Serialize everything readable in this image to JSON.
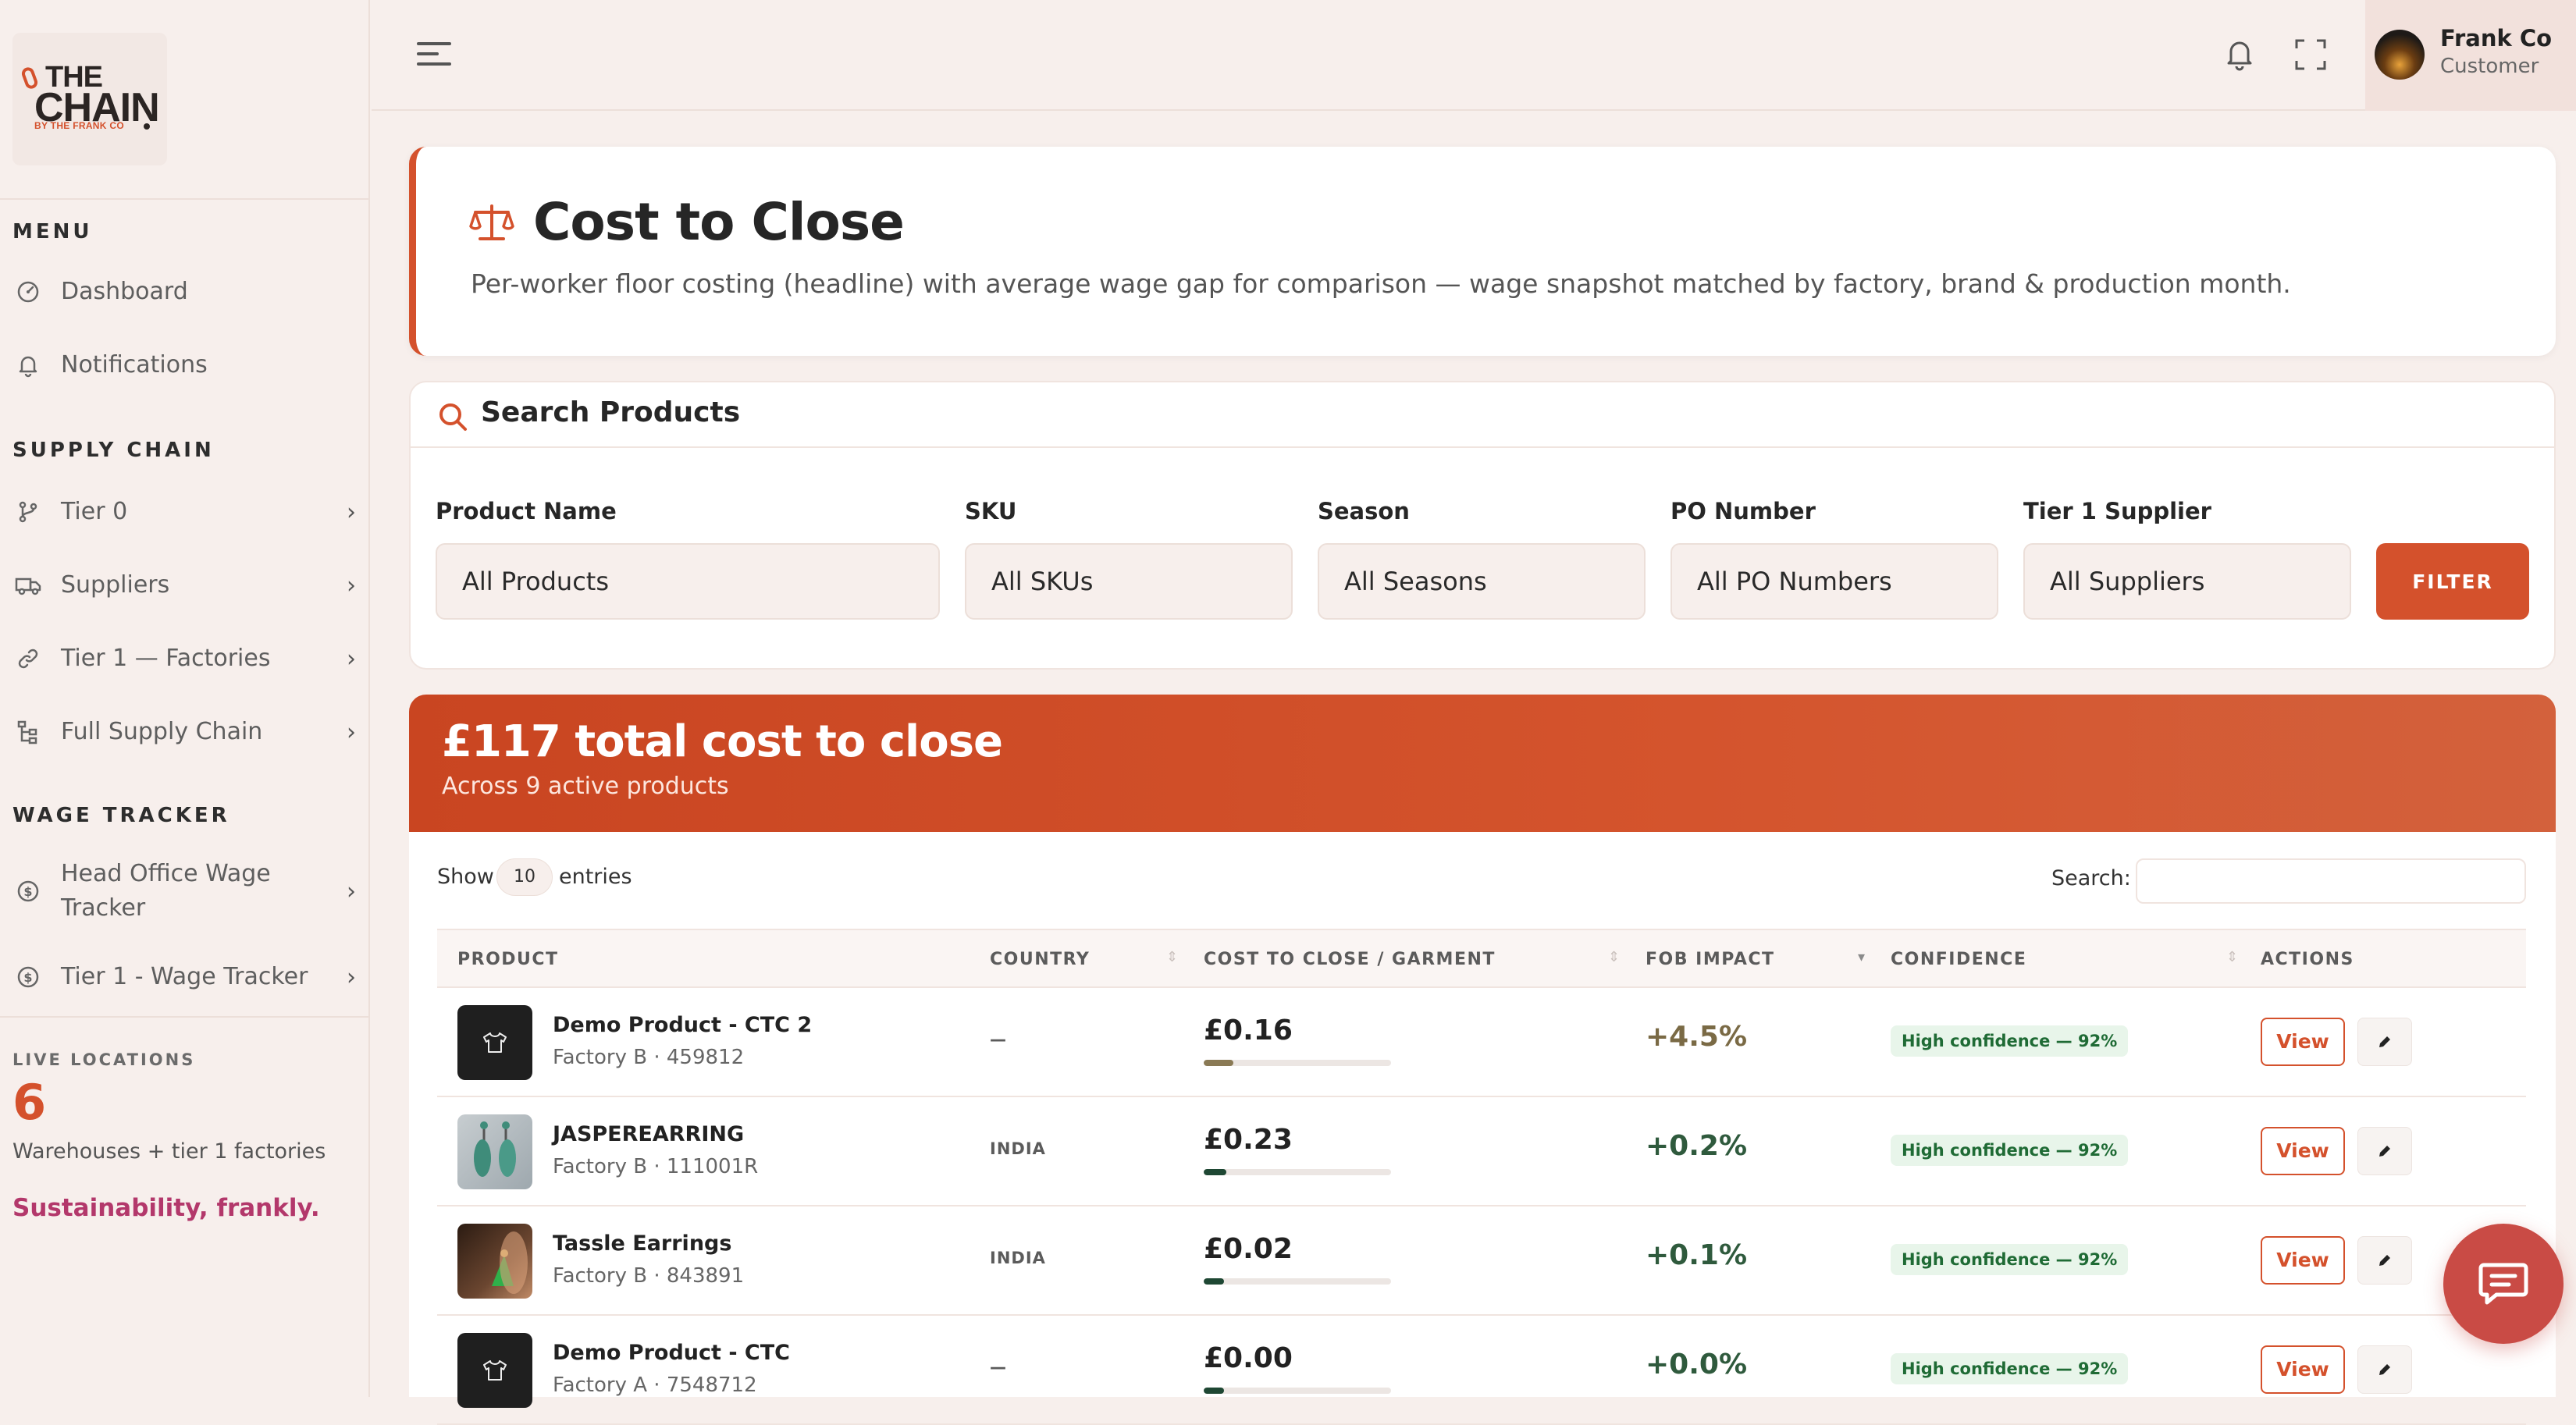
{
  "brand": {
    "logo_top": "THE",
    "logo_main": "CHAIN",
    "logo_by": "BY THE FRANK CO"
  },
  "sidebar": {
    "menu_heading": "MENU",
    "menu_items": [
      {
        "label": "Dashboard",
        "icon": "gauge-icon"
      },
      {
        "label": "Notifications",
        "icon": "bell-icon"
      }
    ],
    "supply_heading": "SUPPLY CHAIN",
    "supply_items": [
      {
        "label": "Tier 0",
        "icon": "branch-icon"
      },
      {
        "label": "Suppliers",
        "icon": "truck-icon"
      },
      {
        "label": "Tier 1 — Factories",
        "icon": "link-icon"
      },
      {
        "label": "Full Supply Chain",
        "icon": "hierarchy-icon"
      }
    ],
    "wage_heading": "WAGE TRACKER",
    "wage_items": [
      {
        "label": "Head Office Wage Tracker",
        "icon": "coin-icon"
      },
      {
        "label": "Tier 1 - Wage Tracker",
        "icon": "coin-icon"
      }
    ],
    "live_label": "LIVE LOCATIONS",
    "live_count": "6",
    "live_sub": "Warehouses + tier 1 factories",
    "tagline": "Sustainability, frankly."
  },
  "topbar": {
    "user_name": "Frank Co",
    "user_role": "Customer"
  },
  "header": {
    "title": "Cost to Close",
    "subtitle": "Per-worker floor costing (headline) with average wage gap for comparison — wage snapshot matched by factory, brand & production month."
  },
  "search": {
    "title": "Search Products",
    "filters": [
      {
        "label": "Product Name",
        "value": "All Products"
      },
      {
        "label": "SKU",
        "value": "All SKUs"
      },
      {
        "label": "Season",
        "value": "All Seasons"
      },
      {
        "label": "PO Number",
        "value": "All PO Numbers"
      },
      {
        "label": "Tier 1 Supplier",
        "value": "All Suppliers"
      }
    ],
    "filter_button": "FILTER"
  },
  "banner": {
    "title": "£117 total cost to close",
    "subtitle": "Across 9 active products"
  },
  "table": {
    "show_label": "Show",
    "show_value": "10",
    "entries_label": "entries",
    "search_label": "Search:",
    "columns": [
      "PRODUCT",
      "COUNTRY",
      "COST TO CLOSE / GARMENT",
      "FOB IMPACT",
      "CONFIDENCE",
      "ACTIONS"
    ],
    "view_label": "View",
    "rows": [
      {
        "name": "Demo Product - CTC 2",
        "sub": "Factory B · 459812",
        "country": "—",
        "ctc": "£0.16",
        "ctc_fraction": 0.16,
        "ctc_color": "#8a7a55",
        "fob": "+4.5%",
        "fob_color": "#7a6a45",
        "confidence": "High confidence — 92%",
        "thumb": "shirt"
      },
      {
        "name": "JASPEREARRING",
        "sub": "Factory B · 111001R",
        "country": "INDIA",
        "ctc": "£0.23",
        "ctc_fraction": 0.12,
        "ctc_color": "#1e4733",
        "fob": "+0.2%",
        "fob_color": "#2f5a3d",
        "confidence": "High confidence — 92%",
        "thumb": "earring"
      },
      {
        "name": "Tassle Earrings",
        "sub": "Factory B · 843891",
        "country": "INDIA",
        "ctc": "£0.02",
        "ctc_fraction": 0.11,
        "ctc_color": "#1e4733",
        "fob": "+0.1%",
        "fob_color": "#2f5a3d",
        "confidence": "High confidence — 92%",
        "thumb": "tassle"
      },
      {
        "name": "Demo Product - CTC",
        "sub": "Factory A · 7548712",
        "country": "—",
        "ctc": "£0.00",
        "ctc_fraction": 0.11,
        "ctc_color": "#1e4733",
        "fob": "+0.0%",
        "fob_color": "#2f5a3d",
        "confidence": "High confidence — 92%",
        "thumb": "shirt"
      }
    ]
  }
}
